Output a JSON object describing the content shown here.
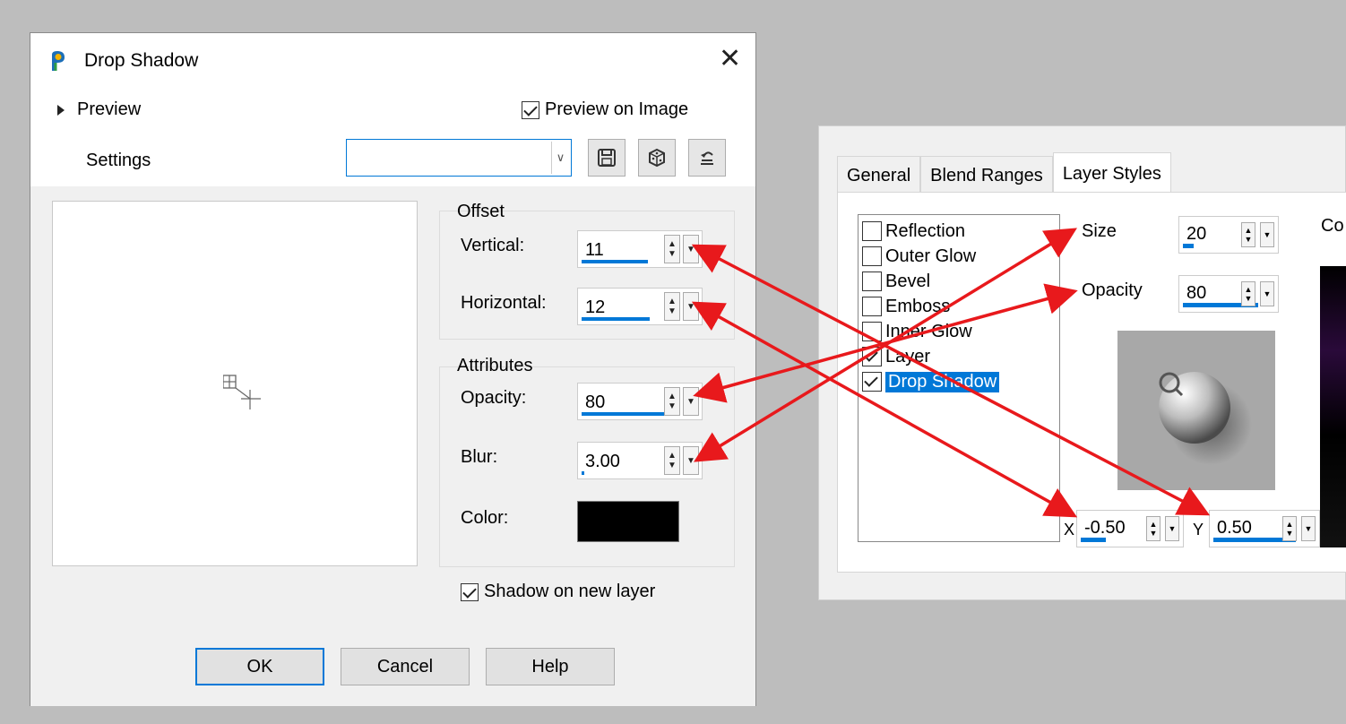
{
  "dialog": {
    "title": "Drop Shadow",
    "preview_label": "Preview",
    "preview_on_image_label": "Preview on Image",
    "preview_on_image_checked": true,
    "settings_label": "Settings",
    "settings_value": "",
    "offset": {
      "group_title": "Offset",
      "vertical_label": "Vertical:",
      "vertical_value": "11",
      "horizontal_label": "Horizontal:",
      "horizontal_value": "12"
    },
    "attributes": {
      "group_title": "Attributes",
      "opacity_label": "Opacity:",
      "opacity_value": "80",
      "blur_label": "Blur:",
      "blur_value": "3.00",
      "color_label": "Color:",
      "color_value": "#000000"
    },
    "shadow_on_new_layer_label": "Shadow on new layer",
    "shadow_on_new_layer_checked": true,
    "buttons": {
      "ok": "OK",
      "cancel": "Cancel",
      "help": "Help"
    }
  },
  "layer_styles_panel": {
    "tabs": [
      "General",
      "Blend Ranges",
      "Layer Styles"
    ],
    "active_tab": "Layer Styles",
    "style_list": [
      {
        "label": "Reflection",
        "checked": false
      },
      {
        "label": "Outer Glow",
        "checked": false
      },
      {
        "label": "Bevel",
        "checked": false
      },
      {
        "label": "Emboss",
        "checked": false
      },
      {
        "label": "Inner Glow",
        "checked": false
      },
      {
        "label": "Layer",
        "checked": true
      },
      {
        "label": "Drop Shadow",
        "checked": true,
        "selected": true
      }
    ],
    "size_label": "Size",
    "size_value": "20",
    "opacity_label": "Opacity",
    "opacity_value": "80",
    "x_label": "X",
    "x_value": "-0.50",
    "y_label": "Y",
    "y_value": "0.50",
    "color_label_partial": "Co"
  },
  "accent_color": "#0078d7",
  "annotation_arrow_color": "#e8191c"
}
